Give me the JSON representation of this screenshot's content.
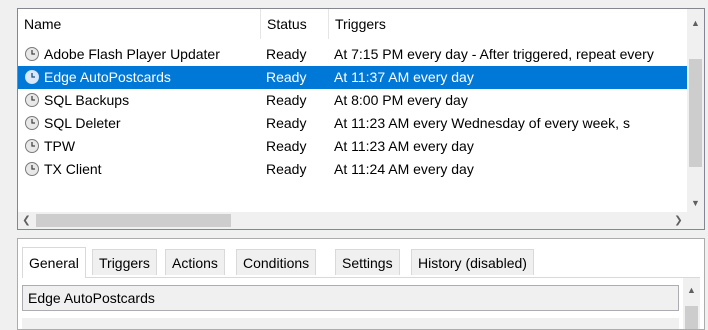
{
  "columns": {
    "name": "Name",
    "status": "Status",
    "triggers": "Triggers"
  },
  "tasks": [
    {
      "name": "Adobe Flash Player Updater",
      "status": "Ready",
      "triggers": "At 7:15 PM every day - After triggered, repeat every"
    },
    {
      "name": "Edge AutoPostcards",
      "status": "Ready",
      "triggers": "At 11:37 AM every day"
    },
    {
      "name": "SQL Backups",
      "status": "Ready",
      "triggers": "At 8:00 PM every day"
    },
    {
      "name": "SQL Deleter",
      "status": "Ready",
      "triggers": "At 11:23 AM every Wednesday of every week, s"
    },
    {
      "name": "TPW",
      "status": "Ready",
      "triggers": "At 11:23 AM every day"
    },
    {
      "name": "TX Client",
      "status": "Ready",
      "triggers": "At 11:24 AM every day"
    }
  ],
  "selected_task_index": 1,
  "colors": {
    "selection": "#0078d7",
    "pane_border": "#828790",
    "scroll_thumb": "#cdcdcd"
  },
  "icons": {
    "task": "clock-icon",
    "scroll_up": "chevron-up-icon",
    "scroll_down": "chevron-down-icon",
    "scroll_left": "chevron-left-icon",
    "scroll_right": "chevron-right-icon"
  },
  "tabs": [
    {
      "label": "General",
      "active": true
    },
    {
      "label": "Triggers",
      "active": false
    },
    {
      "label": "Actions",
      "active": false
    },
    {
      "label": "Conditions",
      "active": false
    },
    {
      "label": "Settings",
      "active": false
    },
    {
      "label": "History (disabled)",
      "active": false
    }
  ],
  "general": {
    "task_name_value": "Edge AutoPostcards"
  }
}
